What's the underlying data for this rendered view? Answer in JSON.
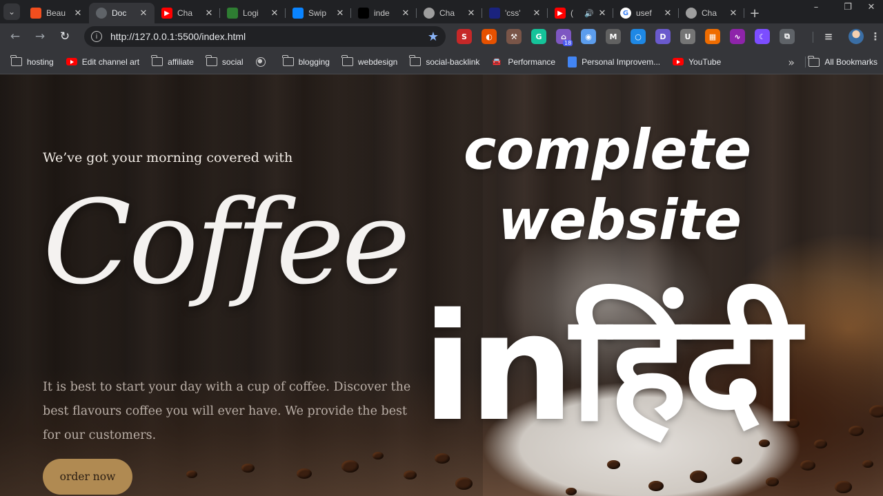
{
  "tabs": [
    {
      "title": "Beau",
      "favicon": "figma-icon",
      "color": "#f24e1e"
    },
    {
      "title": "Doc",
      "favicon": "globe-icon",
      "color": "#5f6368",
      "active": true
    },
    {
      "title": "Cha",
      "favicon": "youtube-icon",
      "color": "#ff0000"
    },
    {
      "title": "Logi",
      "favicon": "code-icon",
      "color": "#2e7d32"
    },
    {
      "title": "Swip",
      "favicon": "swiper-icon",
      "color": "#0a84ff"
    },
    {
      "title": "inde",
      "favicon": "square-icon",
      "color": "#000000"
    },
    {
      "title": "Cha",
      "favicon": "chatgpt-icon",
      "color": "#9e9e9e"
    },
    {
      "title": "'css'",
      "favicon": "dot-icon",
      "color": "#1a237e"
    },
    {
      "title": "(",
      "favicon": "youtube-icon",
      "color": "#ff0000",
      "audio": true
    },
    {
      "title": "usef",
      "favicon": "google-icon",
      "color": "#ffffff"
    },
    {
      "title": "Cha",
      "favicon": "chatgpt-icon",
      "color": "#9e9e9e"
    }
  ],
  "toolbar": {
    "url": "http://127.0.0.1:5500/index.html"
  },
  "extensions": [
    {
      "name": "s-extension-icon",
      "label": "S",
      "color": "#c62828"
    },
    {
      "name": "moon-extension-icon",
      "label": "◐",
      "color": "#e65100"
    },
    {
      "name": "tools-extension-icon",
      "label": "⚒",
      "color": "#795548"
    },
    {
      "name": "grammarly-extension-icon",
      "label": "G",
      "color": "#15c39a"
    },
    {
      "name": "home-extension-icon",
      "label": "⌂",
      "color": "#7e57c2",
      "badge": "18"
    },
    {
      "name": "camera-extension-icon",
      "label": "◉",
      "color": "#5c9ded"
    },
    {
      "name": "m-extension-icon",
      "label": "M",
      "color": "#616161"
    },
    {
      "name": "circle-extension-icon",
      "label": "○",
      "color": "#1e88e5"
    },
    {
      "name": "d-extension-icon",
      "label": "D",
      "color": "#6a5acd"
    },
    {
      "name": "u-extension-icon",
      "label": "U",
      "color": "#757575"
    },
    {
      "name": "calc-extension-icon",
      "label": "▦",
      "color": "#ef6c00"
    },
    {
      "name": "wave-extension-icon",
      "label": "∿",
      "color": "#8e24aa"
    },
    {
      "name": "crescent-extension-icon",
      "label": "☾",
      "color": "#7c4dff"
    },
    {
      "name": "puzzle-extension-icon",
      "label": "⧉",
      "color": "#5f6368"
    }
  ],
  "bookmarks": [
    {
      "label": "hosting",
      "icon": "folder"
    },
    {
      "label": "Edit channel art",
      "icon": "youtube"
    },
    {
      "label": "affiliate",
      "icon": "folder"
    },
    {
      "label": "social",
      "icon": "folder"
    },
    {
      "label": "",
      "icon": "globe"
    },
    {
      "label": "blogging",
      "icon": "folder"
    },
    {
      "label": "webdesign",
      "icon": "folder"
    },
    {
      "label": "social-backlink",
      "icon": "folder"
    },
    {
      "label": "Performance",
      "icon": "car"
    },
    {
      "label": "Personal Improvem...",
      "icon": "doc"
    },
    {
      "label": "YouTube",
      "icon": "youtube"
    }
  ],
  "all_bookmarks": "All Bookmarks",
  "page": {
    "eyebrow": "We’ve got your morning covered with",
    "title": "Coffee",
    "description": "It is best to start your day with a cup of coffee. Discover the best flavours coffee you will ever have. We provide the best for our customers.",
    "button": "order now"
  },
  "overlay": {
    "line1": "complete",
    "line2": "website",
    "line3": "inहिंदी"
  }
}
